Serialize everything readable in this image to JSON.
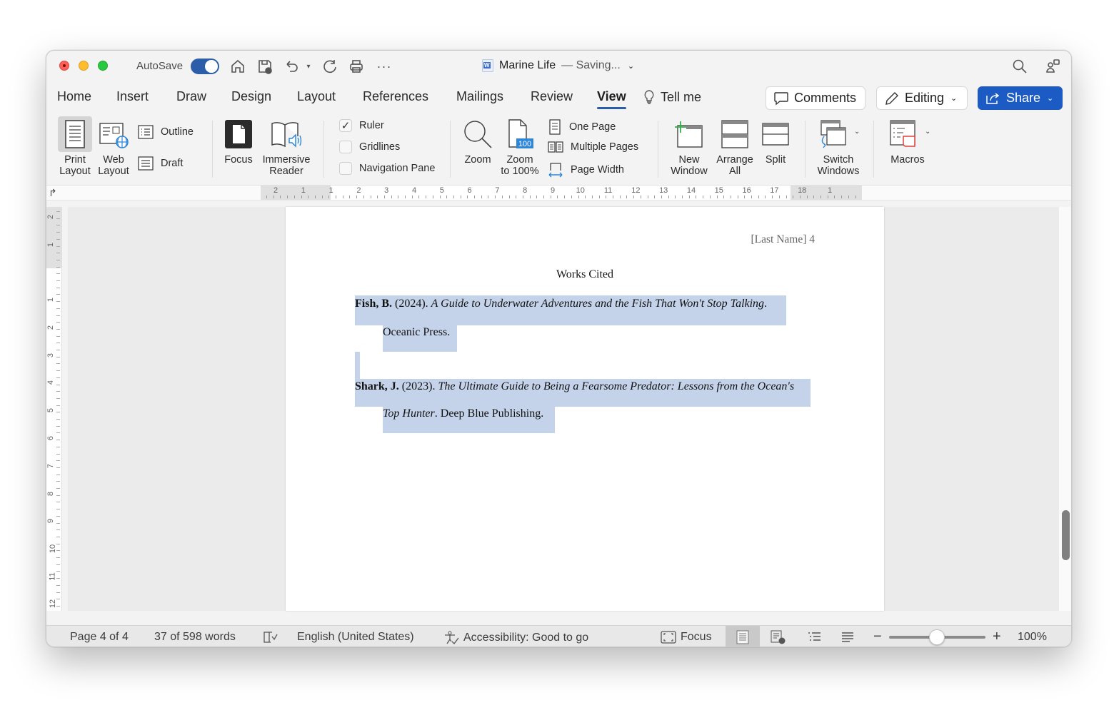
{
  "titlebar": {
    "autosave_label": "AutoSave",
    "autosave_on": true,
    "document_name": "Marine Life",
    "document_status": "— Saving...",
    "quick_access": [
      "home-icon",
      "save-icon",
      "undo-icon",
      "undo-dropdown-icon",
      "redo-icon",
      "print-icon",
      "more-icon"
    ],
    "right_icons": [
      "search-icon",
      "share-people-icon"
    ]
  },
  "tabs": [
    {
      "label": "Home",
      "active": false
    },
    {
      "label": "Insert",
      "active": false
    },
    {
      "label": "Draw",
      "active": false
    },
    {
      "label": "Design",
      "active": false
    },
    {
      "label": "Layout",
      "active": false
    },
    {
      "label": "References",
      "active": false
    },
    {
      "label": "Mailings",
      "active": false
    },
    {
      "label": "Review",
      "active": false
    },
    {
      "label": "View",
      "active": true
    }
  ],
  "tell_me": "Tell me",
  "actions": {
    "comments": "Comments",
    "editing": "Editing",
    "share": "Share"
  },
  "ribbon": {
    "print_layout": [
      "Print",
      "Layout"
    ],
    "web_layout": [
      "Web",
      "Layout"
    ],
    "outline": "Outline",
    "draft": "Draft",
    "focus": "Focus",
    "immersive_reader": [
      "Immersive",
      "Reader"
    ],
    "ruler": {
      "label": "Ruler",
      "checked": true
    },
    "gridlines": {
      "label": "Gridlines",
      "checked": false
    },
    "navigation_pane": {
      "label": "Navigation Pane",
      "checked": false
    },
    "zoom": "Zoom",
    "zoom_100": [
      "Zoom",
      "to 100%"
    ],
    "zoom_100_badge": "100",
    "one_page": "One Page",
    "multiple_pages": "Multiple Pages",
    "page_width": "Page Width",
    "new_window": [
      "New",
      "Window"
    ],
    "arrange_all": [
      "Arrange",
      "All"
    ],
    "split": "Split",
    "switch_windows": [
      "Switch",
      "Windows"
    ],
    "macros": "Macros"
  },
  "ruler": {
    "horizontal_labels": [
      "2",
      "1",
      "1",
      "2",
      "3",
      "4",
      "5",
      "6",
      "7",
      "8",
      "9",
      "10",
      "11",
      "12",
      "13",
      "14",
      "15",
      "16",
      "17",
      "18",
      "1"
    ],
    "vertical_labels": [
      "2",
      "1",
      "1",
      "2",
      "3",
      "4",
      "5",
      "6",
      "7",
      "8",
      "9",
      "10",
      "11",
      "12"
    ]
  },
  "document": {
    "header": "[Last Name] 4",
    "heading": "Works Cited",
    "entries": [
      {
        "author": "Fish, B.",
        "year": " (2024). ",
        "title_line1": "A Guide to Underwater Adventures and the Fish That Won't Stop Talking",
        "after_title_line1": ".",
        "title_line2": "",
        "publisher": "Oceanic Press."
      },
      {
        "author": "Shark, J.",
        "year": " (2023). ",
        "title_line1": "The Ultimate Guide to Being a Fearsome Predator: Lessons from the Ocean's",
        "after_title_line1": "",
        "title_line2": "Top Hunter",
        "publisher": ". Deep Blue Publishing."
      }
    ]
  },
  "statusbar": {
    "page": "Page 4 of 4",
    "words": "37 of 598 words",
    "language": "English (United States)",
    "accessibility": "Accessibility: Good to go",
    "focus": "Focus",
    "zoom_level": "100%",
    "zoom_percent": 100
  },
  "colors": {
    "accent": "#2c5da8",
    "share_button": "#1c5bc4",
    "selection": "#c5d3ea"
  }
}
